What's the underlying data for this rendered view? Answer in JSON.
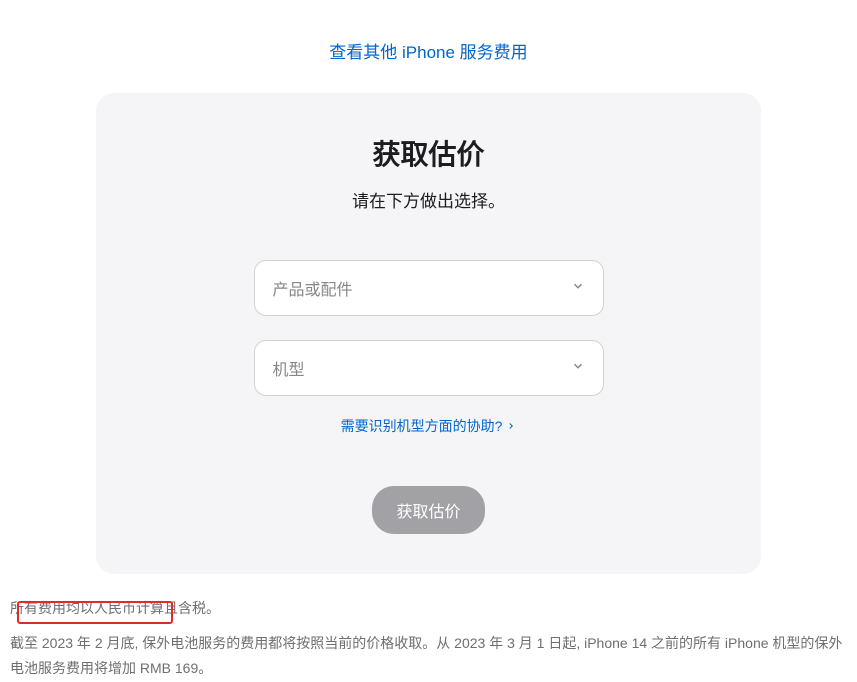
{
  "topLink": {
    "label": "查看其他 iPhone 服务费用"
  },
  "card": {
    "title": "获取估价",
    "subtitle": "请在下方做出选择。",
    "select1": {
      "placeholder": "产品或配件"
    },
    "select2": {
      "placeholder": "机型"
    },
    "helpLink": {
      "label": "需要识别机型方面的协助?"
    },
    "submit": {
      "label": "获取估价"
    }
  },
  "footer": {
    "line1": "所有费用均以人民币计算且含税。",
    "line2": "截至 2023 年 2 月底, 保外电池服务的费用都将按照当前的价格收取。从 2023 年 3 月 1 日起, iPhone 14 之前的所有 iPhone 机型的保外电池服务费用将增加 RMB 169。"
  }
}
